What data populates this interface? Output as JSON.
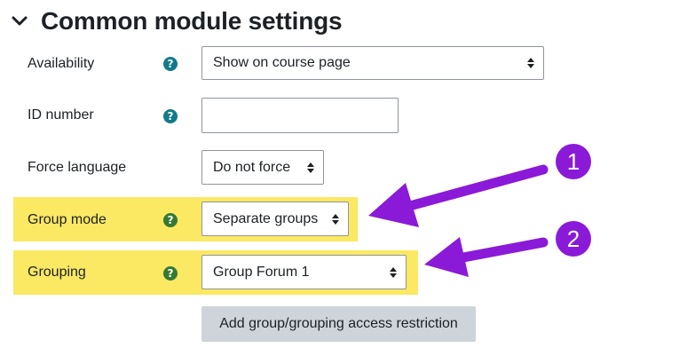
{
  "section": {
    "title": "Common module settings",
    "toggle_icon": "chevron-down-icon"
  },
  "fields": [
    {
      "label": "Availability",
      "help_icon": "question-circle-icon",
      "value": "Show on course page",
      "type": "select"
    },
    {
      "label": "ID number",
      "help_icon": "question-circle-icon",
      "value": "",
      "type": "text"
    },
    {
      "label": "Force language",
      "value": "Do not force",
      "type": "select"
    },
    {
      "label": "Group mode",
      "help_icon": "question-circle-icon",
      "value": "Separate groups",
      "type": "select",
      "highlighted": true
    },
    {
      "label": "Grouping",
      "help_icon": "question-circle-icon",
      "value": "Group Forum 1",
      "type": "select",
      "highlighted": true
    }
  ],
  "restriction_button": {
    "label": "Add group/grouping access restriction"
  },
  "annotations": [
    {
      "number": "1"
    },
    {
      "number": "2"
    }
  ],
  "colors": {
    "highlight": "#fbe863",
    "annotation": "#8a1ad8",
    "help_blue": "#117a8b",
    "help_green": "#357a32"
  }
}
